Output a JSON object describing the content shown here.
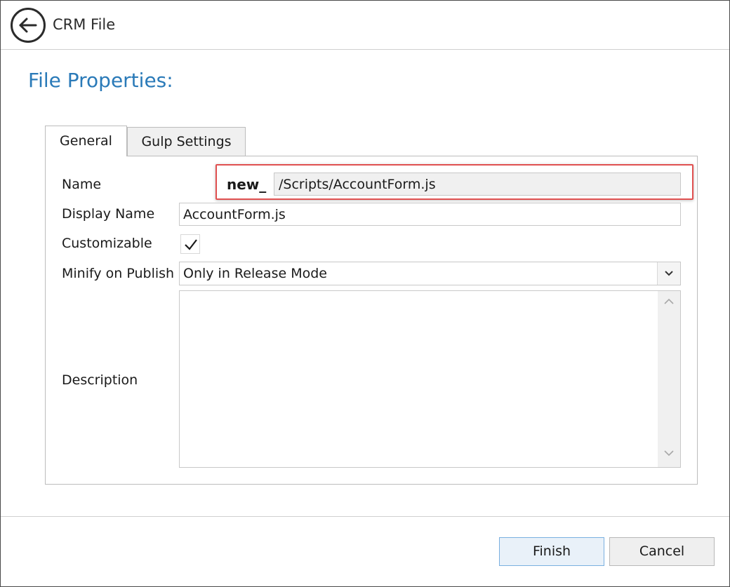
{
  "window": {
    "title": "CRM File",
    "back_icon": "arrow-left-circle-icon"
  },
  "page": {
    "section_title": "File Properties:"
  },
  "tabs": [
    {
      "label": "General",
      "active": true
    },
    {
      "label": "Gulp Settings",
      "active": false
    }
  ],
  "form": {
    "name": {
      "label": "Name",
      "prefix": "new_",
      "value": "/Scripts/AccountForm.js"
    },
    "display_name": {
      "label": "Display Name",
      "value": "AccountForm.js"
    },
    "customizable": {
      "label": "Customizable",
      "checked": true
    },
    "minify": {
      "label": "Minify on Publish",
      "value": "Only in Release Mode"
    },
    "description": {
      "label": "Description",
      "value": ""
    }
  },
  "buttons": {
    "finish": "Finish",
    "cancel": "Cancel"
  },
  "colors": {
    "title_accent": "#2a7ab8",
    "highlight_border": "#e05050",
    "primary_button_border": "#7ab0e0"
  }
}
